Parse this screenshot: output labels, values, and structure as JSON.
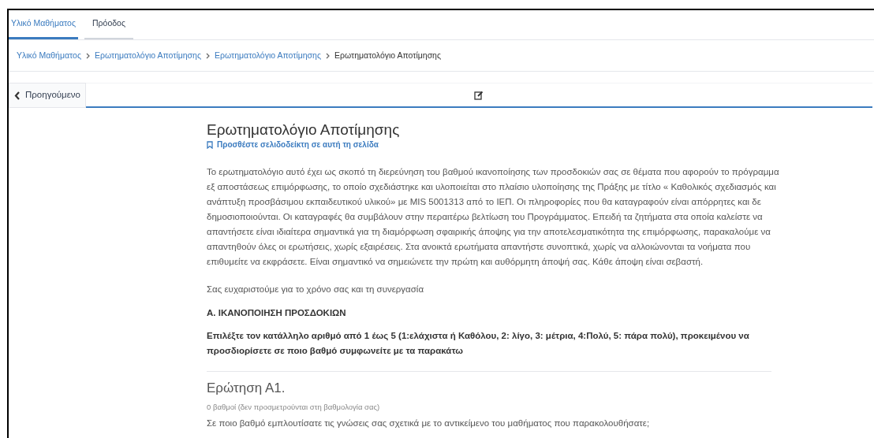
{
  "tabs": [
    {
      "label": "Υλικό Μαθήματος",
      "selected": true
    },
    {
      "label": "Πρόοδος",
      "selected": false
    }
  ],
  "breadcrumb": [
    {
      "label": "Υλικό Μαθήματος",
      "link": true
    },
    {
      "label": "Ερωτηματολόγιο Αποτίμησης",
      "link": true
    },
    {
      "label": "Ερωτηματολόγιο Αποτίμησης",
      "link": true
    },
    {
      "label": "Ερωτηματολόγιο Αποτίμησης",
      "link": false
    }
  ],
  "nav": {
    "previous": "Προηγούμενο"
  },
  "content": {
    "title": "Ερωτηματολόγιο Αποτίμησης",
    "bookmark": "Προσθέστε σελιδοδείκτη σε αυτή τη σελίδα",
    "intro": "Το ερωτηματολόγιο αυτό έχει ως σκοπό τη διερεύνηση του βαθμού ικανοποίησης των προσδοκιών σας σε θέματα που αφορούν το πρόγραμμα εξ αποστάσεως επιμόρφωσης, το οποίο σχεδιάστηκε και υλοποιείται στο πλαίσιο υλοποίησης της Πράξης με τίτλο « Καθολικός σχεδιασμός και ανάπτυξη προσβάσιμου εκπαιδευτικού υλικού» με MIS 5001313 από το ΙΕΠ. Οι πληροφορίες που θα καταγραφούν είναι απόρρητες και δε δημοσιοποιούνται. Οι καταγραφές θα συμβάλουν στην περαιτέρω βελτίωση του Προγράμματος. Επειδή τα ζητήματα στα οποία καλείστε να απαντήσετε είναι ιδιαίτερα σημαντικά για τη διαμόρφωση σφαιρικής άποψης για την αποτελεσματικότητα της επιμόρφωσης, παρακαλούμε να απαντηθούν όλες οι ερωτήσεις, χωρίς εξαιρέσεις. Στα ανοικτά ερωτήματα απαντήστε συνοπτικά, χωρίς να αλλοιώνονται τα νοήματα που επιθυμείτε να εκφράσετε. Είναι σημαντικό να σημειώνετε την πρώτη και αυθόρμητη άποψή σας. Κάθε άποψη είναι σεβαστή.",
    "thanks": "Σας ευχαριστούμε για το χρόνο σας και τη συνεργασία",
    "section": "Α. ΙΚΑΝΟΠΟΙΗΣΗ ΠΡΟΣΔΟΚΙΩΝ",
    "instruction": "Επιλέξτε τον κατάλληλο αριθμό από 1 έως 5 (1:ελάχιστα ή Καθόλου, 2: λίγο, 3: μέτρια, 4:Πολύ, 5: πάρα πολύ), προκειμένου να προσδιορίσετε σε ποιο βαθμό συμφωνείτε με τα παρακάτω",
    "question": {
      "title": "Ερώτηση Α1.",
      "points": "0 βαθμοί (δεν προσμετρούνται στη βαθμολογία σας)",
      "text": "Σε ποιο βαθμό εμπλουτίσατε τις γνώσεις σας σχετικά με το αντικείμενο του μαθήματος που παρακολουθήσατε;"
    }
  }
}
